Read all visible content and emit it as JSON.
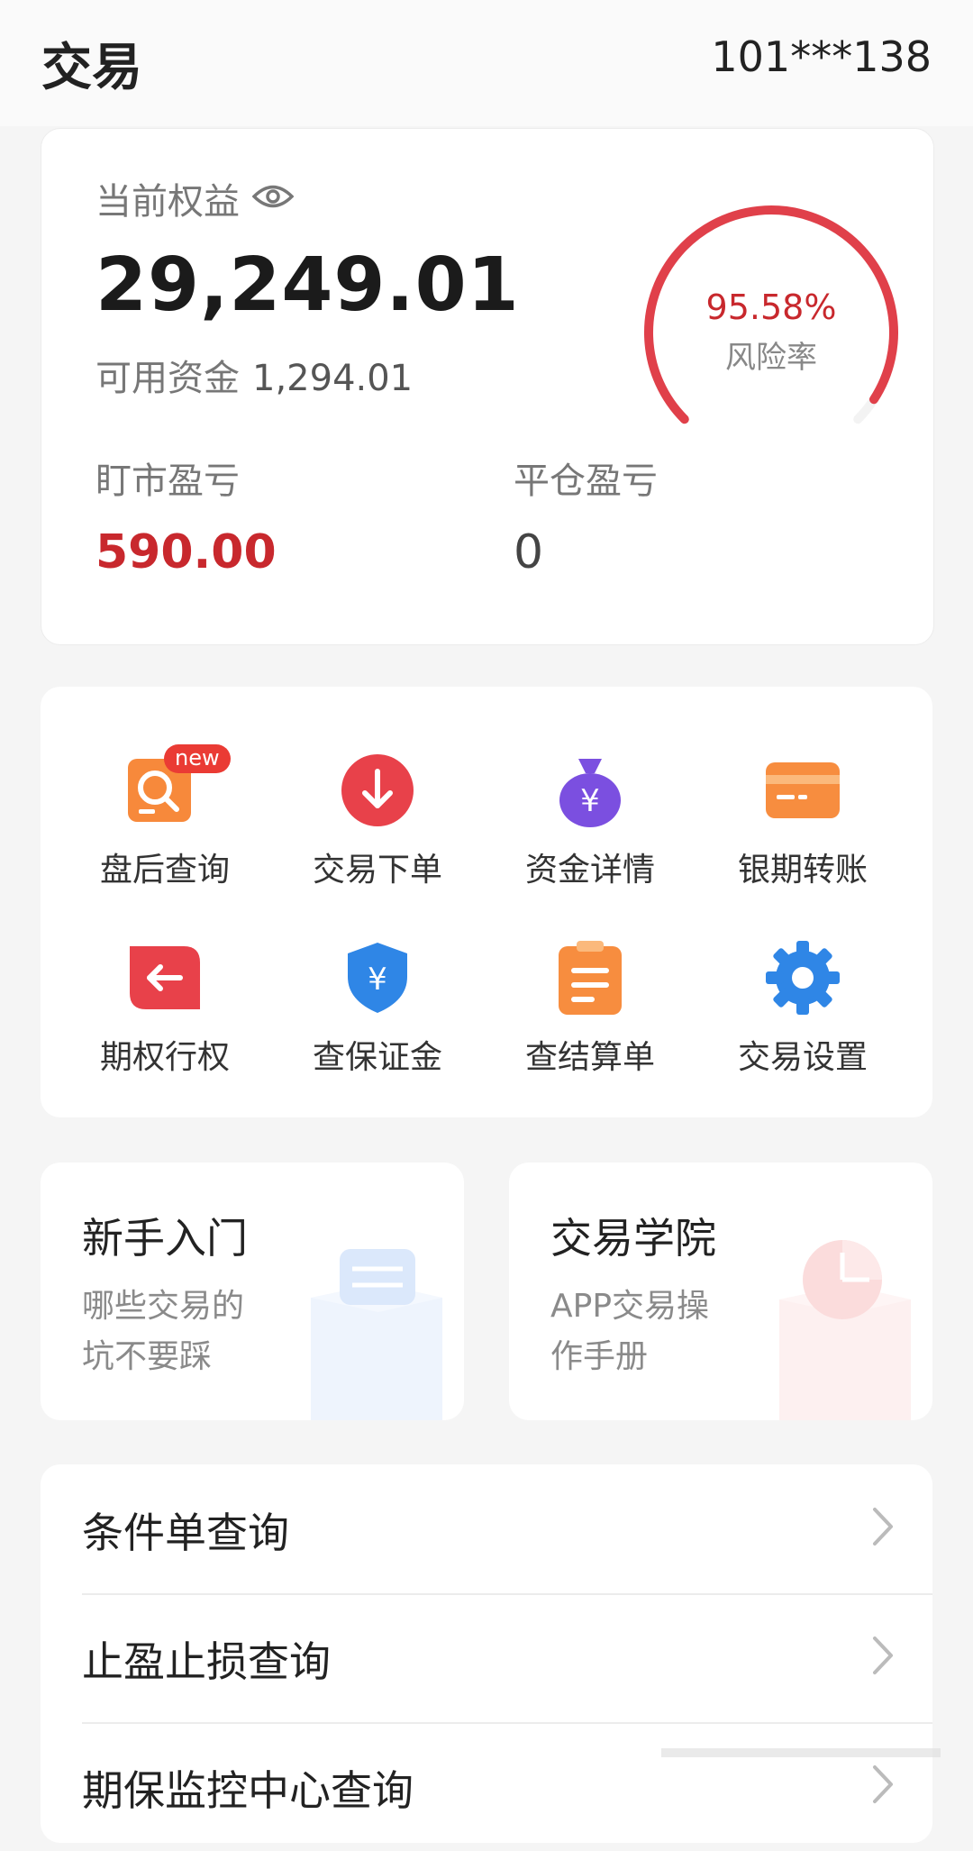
{
  "header": {
    "title": "交易",
    "account": "101***138"
  },
  "equity": {
    "label": "当前权益",
    "value": "29,249.01",
    "available_label": "可用资金",
    "available_value": "1,294.01",
    "risk_value": "95.58%",
    "risk_label": "风险率",
    "risk_percent": 95.58,
    "floating_pl_label": "盯市盈亏",
    "floating_pl_value": "590.00",
    "closing_pl_label": "平仓盈亏",
    "closing_pl_value": "0"
  },
  "menu": {
    "badge": "new",
    "items": [
      {
        "label": "盘后查询",
        "icon": "search-doc-icon"
      },
      {
        "label": "交易下单",
        "icon": "arrow-down-circle-icon"
      },
      {
        "label": "资金详情",
        "icon": "money-bag-icon"
      },
      {
        "label": "银期转账",
        "icon": "bank-card-icon"
      },
      {
        "label": "期权行权",
        "icon": "arrow-left-icon"
      },
      {
        "label": "查保证金",
        "icon": "shield-yen-icon"
      },
      {
        "label": "查结算单",
        "icon": "clipboard-icon"
      },
      {
        "label": "交易设置",
        "icon": "gear-icon"
      }
    ]
  },
  "promos": [
    {
      "title": "新手入门",
      "line1": "哪些交易的",
      "line2": "坑不要踩"
    },
    {
      "title": "交易学院",
      "line1": "APP交易操",
      "line2": "作手册"
    }
  ],
  "list": [
    {
      "label": "条件单查询"
    },
    {
      "label": "止盈止损查询"
    },
    {
      "label": "期保监控中心查询"
    }
  ],
  "colors": {
    "accent_red": "#c8282d",
    "gauge_red": "#e0404a",
    "muted": "#777777"
  }
}
